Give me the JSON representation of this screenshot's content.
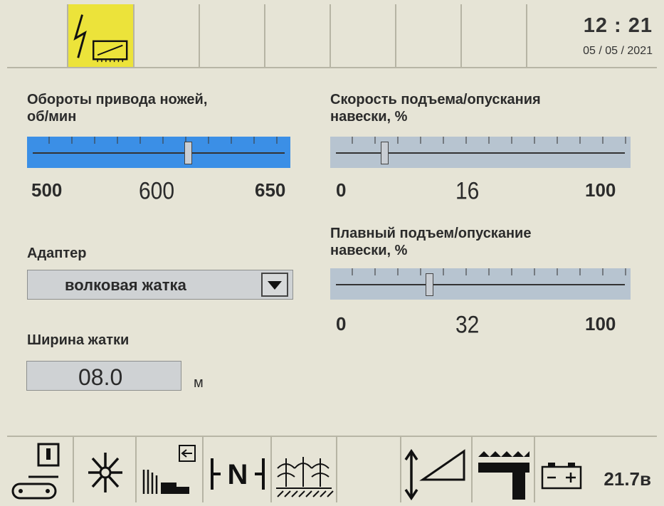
{
  "header": {
    "time": "12 : 21",
    "date": "05 / 05 / 2021",
    "active_tab_icon": "lightning-ramp-icon"
  },
  "knife_drive": {
    "label_line1": "Обороты привода ножей,",
    "label_line2": "об/мин",
    "min": "500",
    "value": "600",
    "max": "650",
    "fraction": 0.62
  },
  "lift_speed": {
    "label_line1": "Скорость подъема/опускания",
    "label_line2": "навески, %",
    "min": "0",
    "value": "16",
    "max": "100",
    "fraction": 0.16
  },
  "smooth_lift": {
    "label_line1": "Плавный подъем/опускание",
    "label_line2": "навески, %",
    "min": "0",
    "value": "32",
    "max": "100",
    "fraction": 0.32
  },
  "adapter": {
    "label": "Адаптер",
    "selected": "волковая жатка"
  },
  "header_width": {
    "label": "Ширина жатки",
    "value": "08.0",
    "unit": "м"
  },
  "bottom_bar": {
    "voltage": "21.7в",
    "icons": [
      "conveyor-icon",
      "fan-icon",
      "header-unload-icon",
      "neutral-icon",
      "crop-icon",
      "blank",
      "lift-ramp-icon",
      "reel-icon",
      "battery-icon"
    ]
  },
  "colors": {
    "active_tab": "#ece33a",
    "blue_slider": "#3b8fe6",
    "grey_slider": "#b7c4d0",
    "background": "#e6e4d6"
  }
}
